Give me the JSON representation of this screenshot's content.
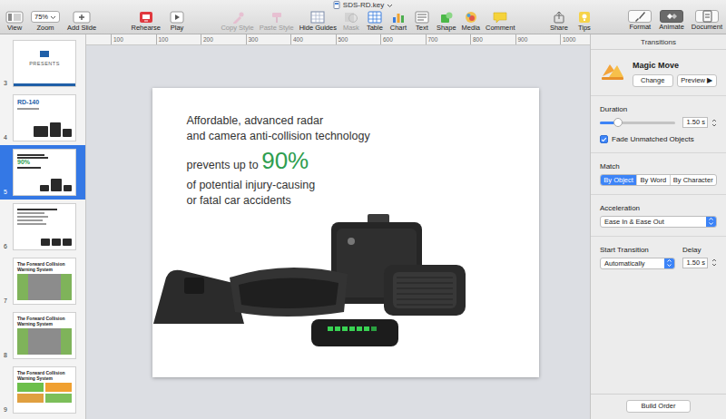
{
  "window": {
    "title": "SDS-RD.key"
  },
  "toolbar": {
    "groups": [
      [
        {
          "label": "View",
          "disabled": false
        },
        {
          "label": "Zoom",
          "value": "75%",
          "disabled": false
        },
        {
          "label": "Add Slide",
          "disabled": false
        }
      ],
      [
        {
          "label": "Rehearse",
          "disabled": false
        },
        {
          "label": "Play",
          "disabled": false
        }
      ],
      [
        {
          "label": "Copy Style",
          "disabled": true
        },
        {
          "label": "Paste Style",
          "disabled": true
        },
        {
          "label": "Hide Guides",
          "disabled": false
        },
        {
          "label": "Mask",
          "disabled": true
        },
        {
          "label": "Table",
          "disabled": false
        },
        {
          "label": "Chart",
          "disabled": false
        },
        {
          "label": "Text",
          "disabled": false
        },
        {
          "label": "Shape",
          "disabled": false
        },
        {
          "label": "Media",
          "disabled": false
        },
        {
          "label": "Comment",
          "disabled": false
        }
      ],
      [
        {
          "label": "Share",
          "disabled": false
        },
        {
          "label": "Tips",
          "disabled": false
        }
      ],
      [
        {
          "label": "Format",
          "disabled": false,
          "selected": false
        },
        {
          "label": "Animate",
          "disabled": false,
          "selected": true
        },
        {
          "label": "Document",
          "disabled": false,
          "selected": false
        }
      ]
    ]
  },
  "navigator": {
    "slides": [
      {
        "number": "3",
        "kind": "logo",
        "title": "PRESENTS",
        "selected": false
      },
      {
        "number": "4",
        "kind": "product",
        "title": "RD-140",
        "selected": false
      },
      {
        "number": "5",
        "kind": "hero",
        "title": "90%",
        "selected": true
      },
      {
        "number": "6",
        "kind": "bullets",
        "selected": false
      },
      {
        "number": "7",
        "kind": "road",
        "title": "The Forward Collision Warning System",
        "selected": false
      },
      {
        "number": "8",
        "kind": "road",
        "title": "The Forward Collision Warning System",
        "selected": false
      },
      {
        "number": "9",
        "kind": "grid",
        "title": "The Forward Collision Warning System",
        "selected": false
      }
    ]
  },
  "ruler": {
    "ticks": [
      "100",
      "100",
      "200",
      "300",
      "400",
      "500",
      "600",
      "700",
      "800",
      "900",
      "1000"
    ]
  },
  "slide": {
    "lines": [
      {
        "text": "Affordable, advanced radar"
      },
      {
        "text": "and camera anti-collision technology"
      },
      {
        "text": "prevents up to ",
        "emphasis": "90%"
      },
      {
        "text": "of potential injury-causing"
      },
      {
        "text": "or fatal car accidents"
      }
    ]
  },
  "inspector": {
    "title": "Transitions",
    "effect": {
      "name": "Magic Move",
      "buttons": [
        "Change",
        "Preview ▶"
      ]
    },
    "duration": {
      "label": "Duration",
      "level": 0.24,
      "value": "1.50 s"
    },
    "fade": {
      "label": "Fade Unmatched Objects",
      "checked": true
    },
    "match": {
      "label": "Match",
      "options": [
        {
          "label": "By Object",
          "selected": true
        },
        {
          "label": "By Word",
          "selected": false
        },
        {
          "label": "By Character",
          "selected": false
        }
      ]
    },
    "acceleration": {
      "label": "Acceleration",
      "value": "Ease In & Ease Out"
    },
    "start": {
      "label": "Start Transition",
      "value": "Automatically"
    },
    "delay": {
      "label": "Delay",
      "value": "1.50 s"
    },
    "build_order": "Build Order"
  }
}
